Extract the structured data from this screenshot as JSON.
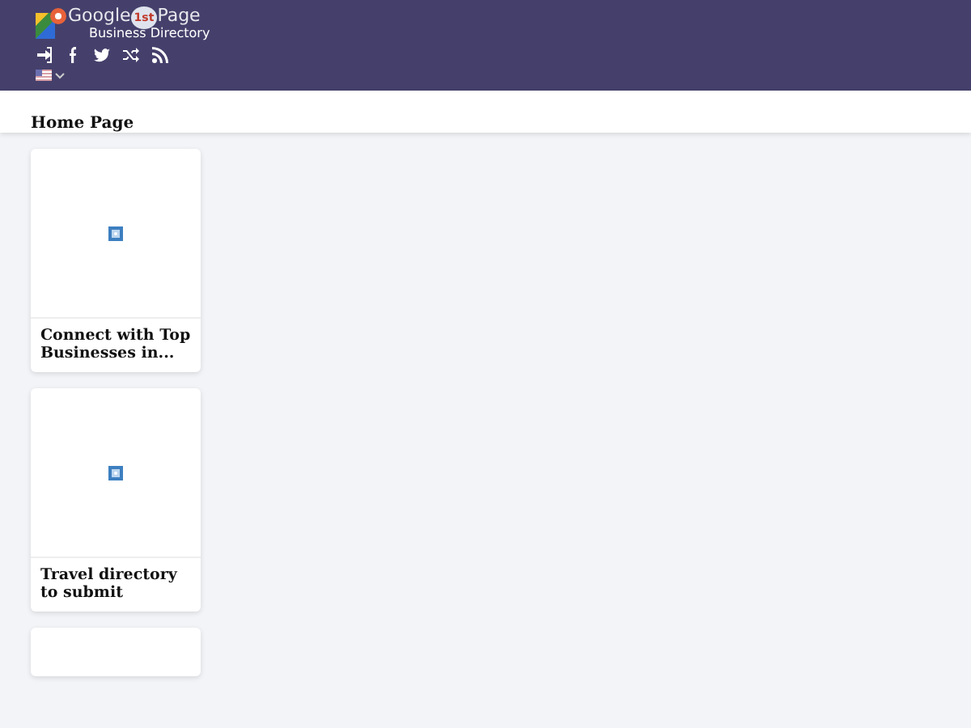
{
  "header": {
    "logo": {
      "word_1": "Google",
      "badge": "1st",
      "word_2": "Page",
      "tagline": "Business Directory"
    }
  },
  "breadcrumb": {
    "title": "Home Page"
  },
  "cards": [
    {
      "kind": "titled",
      "title": "Connect with Top Businesses in..."
    },
    {
      "kind": "titled",
      "title": "Travel directory to submit"
    },
    {
      "kind": "cut_off"
    }
  ]
}
